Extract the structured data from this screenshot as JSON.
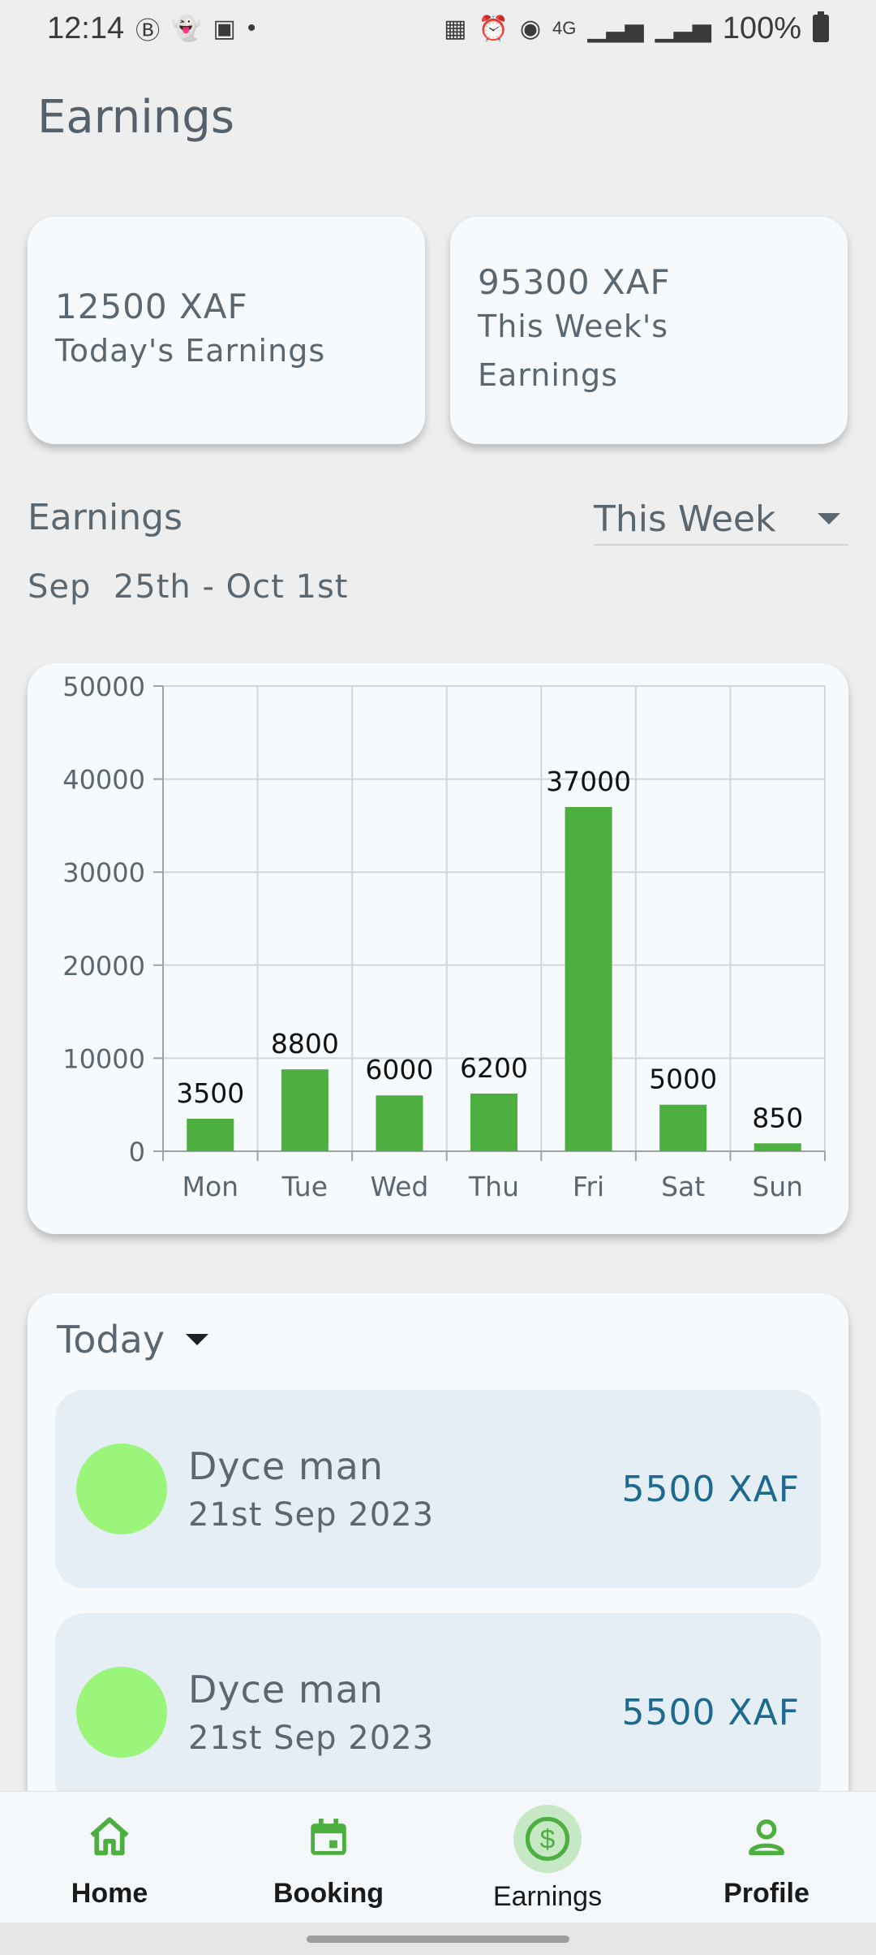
{
  "status_bar": {
    "time": "12:14",
    "battery": "100%",
    "network": "4G"
  },
  "page": {
    "title": "Earnings"
  },
  "summary": {
    "today": {
      "value": "12500 XAF",
      "label": "Today's Earnings"
    },
    "week": {
      "value": "95300 XAF",
      "label_line1": "This Week's",
      "label_line2": "Earnings"
    }
  },
  "earnings_section": {
    "title": "Earnings",
    "period": "This Week",
    "date_range": "Sep  25th - Oct 1st"
  },
  "chart_data": {
    "type": "bar",
    "categories": [
      "Mon",
      "Tue",
      "Wed",
      "Thu",
      "Fri",
      "Sat",
      "Sun"
    ],
    "values": [
      3500,
      8800,
      6000,
      6200,
      37000,
      5000,
      850
    ],
    "ylim": [
      0,
      50000
    ],
    "yticks": [
      0,
      10000,
      20000,
      30000,
      40000,
      50000
    ],
    "grid": true,
    "bar_color": "#4caf3f",
    "data_labels": true
  },
  "transactions": {
    "filter": "Today",
    "items": [
      {
        "name": "Dyce man",
        "date": "21st Sep 2023",
        "amount": "5500 XAF"
      },
      {
        "name": "Dyce man",
        "date": "21st Sep 2023",
        "amount": "5500 XAF"
      }
    ]
  },
  "nav": {
    "items": [
      {
        "label": "Home",
        "icon": "home-icon"
      },
      {
        "label": "Booking",
        "icon": "calendar-icon"
      },
      {
        "label": "Earnings",
        "icon": "dollar-icon"
      },
      {
        "label": "Profile",
        "icon": "person-icon"
      }
    ],
    "active": "Earnings"
  },
  "colors": {
    "accent": "#4caf3f",
    "amount": "#1e6a8e",
    "avatar": "#9af57a"
  }
}
